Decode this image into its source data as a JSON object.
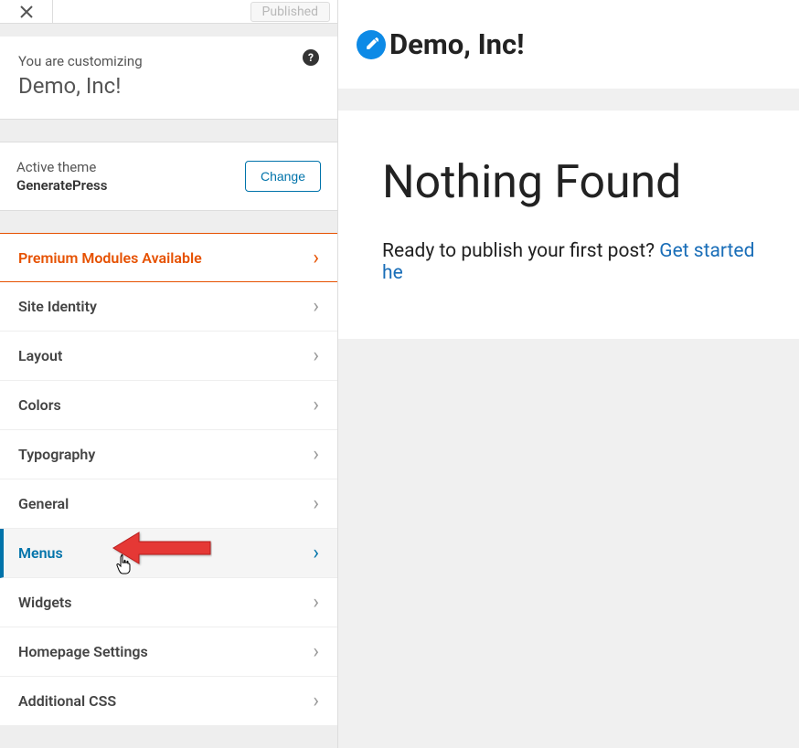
{
  "topbar": {
    "published": "Published"
  },
  "customizing": {
    "label": "You are customizing",
    "site": "Demo, Inc!"
  },
  "theme": {
    "label": "Active theme",
    "name": "GeneratePress",
    "change": "Change"
  },
  "menu": {
    "items": [
      {
        "label": "Premium Modules Available",
        "premium": true,
        "active": false
      },
      {
        "label": "Site Identity",
        "premium": false,
        "active": false
      },
      {
        "label": "Layout",
        "premium": false,
        "active": false
      },
      {
        "label": "Colors",
        "premium": false,
        "active": false
      },
      {
        "label": "Typography",
        "premium": false,
        "active": false
      },
      {
        "label": "General",
        "premium": false,
        "active": false
      },
      {
        "label": "Menus",
        "premium": false,
        "active": true
      },
      {
        "label": "Widgets",
        "premium": false,
        "active": false
      },
      {
        "label": "Homepage Settings",
        "premium": false,
        "active": false
      },
      {
        "label": "Additional CSS",
        "premium": false,
        "active": false
      }
    ]
  },
  "preview": {
    "title": "Demo, Inc!",
    "heading": "Nothing Found",
    "prompt": "Ready to publish your first post? ",
    "link": "Get started he"
  }
}
